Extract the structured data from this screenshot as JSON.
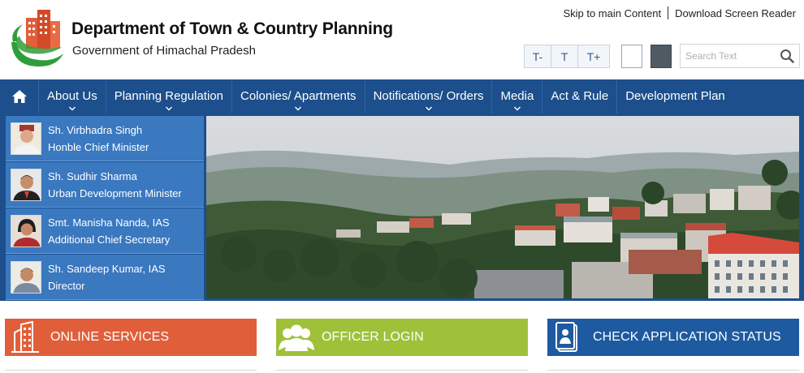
{
  "header": {
    "title": "Department of Town & Country Planning",
    "subtitle": "Government of Himachal Pradesh",
    "top_links": [
      "Skip to main Content",
      "Download Screen Reader"
    ],
    "font_controls": [
      "T-",
      "T",
      "T+"
    ],
    "search_placeholder": "Search Text"
  },
  "nav": {
    "items": [
      {
        "label": "About Us",
        "has_dropdown": true
      },
      {
        "label": "Planning Regulation",
        "has_dropdown": true
      },
      {
        "label": "Colonies/ Apartments",
        "has_dropdown": true
      },
      {
        "label": "Notifications/ Orders",
        "has_dropdown": true
      },
      {
        "label": "Media",
        "has_dropdown": true
      },
      {
        "label": "Act & Rule",
        "has_dropdown": false
      },
      {
        "label": "Development Plan",
        "has_dropdown": false
      }
    ]
  },
  "officials": [
    {
      "name": "Sh. Virbhadra Singh",
      "designation": "Honble Chief Minister"
    },
    {
      "name": "Sh. Sudhir Sharma",
      "designation": "Urban Development Minister"
    },
    {
      "name": "Smt. Manisha Nanda, IAS",
      "designation": "Additional Chief Secretary"
    },
    {
      "name": "Sh. Sandeep Kumar, IAS",
      "designation": "Director"
    }
  ],
  "tiles": {
    "online": "ONLINE SERVICES",
    "officer": "OFFICER LOGIN",
    "status": "CHECK APPLICATION STATUS"
  },
  "colors": {
    "nav_bg": "#1c4f8c",
    "official_bg": "#3a78c0",
    "online_tile": "#e05f3a",
    "officer_tile": "#9fc13a",
    "status_tile": "#1e5aa0"
  }
}
